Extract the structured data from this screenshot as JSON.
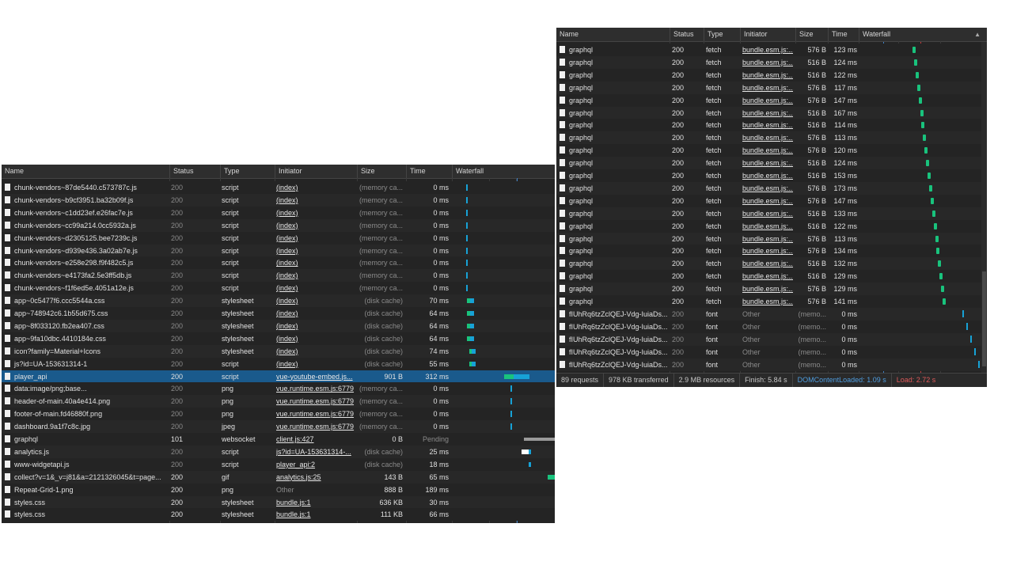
{
  "left": {
    "columns": [
      "Name",
      "Status",
      "Type",
      "Initiator",
      "Size",
      "Time",
      "Waterfall"
    ],
    "rows": [
      {
        "name": "chunk-vendors~87de5440.c573787c.js",
        "status": "200",
        "type": "script",
        "initiator": "(index)",
        "size": "(memory ca...",
        "time": "0 ms",
        "dim": true,
        "wf": "tick"
      },
      {
        "name": "chunk-vendors~b9cf3951.ba32b09f.js",
        "status": "200",
        "type": "script",
        "initiator": "(index)",
        "size": "(memory ca...",
        "time": "0 ms",
        "dim": true,
        "wf": "tick"
      },
      {
        "name": "chunk-vendors~c1dd23ef.e26fac7e.js",
        "status": "200",
        "type": "script",
        "initiator": "(index)",
        "size": "(memory ca...",
        "time": "0 ms",
        "dim": true,
        "wf": "tick"
      },
      {
        "name": "chunk-vendors~cc99a214.0cc5932a.js",
        "status": "200",
        "type": "script",
        "initiator": "(index)",
        "size": "(memory ca...",
        "time": "0 ms",
        "dim": true,
        "wf": "tick"
      },
      {
        "name": "chunk-vendors~d2305125.bee7239c.js",
        "status": "200",
        "type": "script",
        "initiator": "(index)",
        "size": "(memory ca...",
        "time": "0 ms",
        "dim": true,
        "wf": "tick"
      },
      {
        "name": "chunk-vendors~d939e436.3a02ab7e.js",
        "status": "200",
        "type": "script",
        "initiator": "(index)",
        "size": "(memory ca...",
        "time": "0 ms",
        "dim": true,
        "wf": "tick"
      },
      {
        "name": "chunk-vendors~e258e298.f9f482c5.js",
        "status": "200",
        "type": "script",
        "initiator": "(index)",
        "size": "(memory ca...",
        "time": "0 ms",
        "dim": true,
        "wf": "tick"
      },
      {
        "name": "chunk-vendors~e4173fa2.5e3ff5db.js",
        "status": "200",
        "type": "script",
        "initiator": "(index)",
        "size": "(memory ca...",
        "time": "0 ms",
        "dim": true,
        "wf": "tick"
      },
      {
        "name": "chunk-vendors~f1f6ed5e.4051a12e.js",
        "status": "200",
        "type": "script",
        "initiator": "(index)",
        "size": "(memory ca...",
        "time": "0 ms",
        "dim": true,
        "wf": "tick"
      },
      {
        "name": "app~0c5477f6.ccc5544a.css",
        "status": "200",
        "type": "stylesheet",
        "initiator": "(index)",
        "size": "(disk cache)",
        "time": "70 ms",
        "dim": true,
        "wf": "css"
      },
      {
        "name": "app~748942c6.1b55d675.css",
        "status": "200",
        "type": "stylesheet",
        "initiator": "(index)",
        "size": "(disk cache)",
        "time": "64 ms",
        "dim": true,
        "wf": "css"
      },
      {
        "name": "app~8f033120.fb2ea407.css",
        "status": "200",
        "type": "stylesheet",
        "initiator": "(index)",
        "size": "(disk cache)",
        "time": "64 ms",
        "dim": true,
        "wf": "css"
      },
      {
        "name": "app~9fa10dbc.4410184e.css",
        "status": "200",
        "type": "stylesheet",
        "initiator": "(index)",
        "size": "(disk cache)",
        "time": "64 ms",
        "dim": true,
        "wf": "css"
      },
      {
        "name": "icon?family=Material+Icons",
        "status": "200",
        "type": "stylesheet",
        "initiator": "(index)",
        "size": "(disk cache)",
        "time": "74 ms",
        "dim": true,
        "wf": "css2"
      },
      {
        "name": "js?id=UA-153631314-1",
        "status": "200",
        "type": "script",
        "initiator": "(index)",
        "size": "(disk cache)",
        "time": "55 ms",
        "dim": true,
        "wf": "css2"
      },
      {
        "name": "player_api",
        "status": "200",
        "type": "script",
        "initiator": "vue-youtube-embed.js...",
        "size": "901 B",
        "time": "312 ms",
        "dim": false,
        "sel": true,
        "wf": "player"
      },
      {
        "name": "data:image/png;base...",
        "status": "200",
        "type": "png",
        "initiator": "vue.runtime.esm.js:6779",
        "size": "(memory ca...",
        "time": "0 ms",
        "dim": true,
        "wf": "tick2"
      },
      {
        "name": "header-of-main.40a4e414.png",
        "status": "200",
        "type": "png",
        "initiator": "vue.runtime.esm.js:6779",
        "size": "(memory ca...",
        "time": "0 ms",
        "dim": true,
        "wf": "tick2"
      },
      {
        "name": "footer-of-main.fd46880f.png",
        "status": "200",
        "type": "png",
        "initiator": "vue.runtime.esm.js:6779",
        "size": "(memory ca...",
        "time": "0 ms",
        "dim": true,
        "wf": "tick2"
      },
      {
        "name": "dashboard.9a1f7c8c.jpg",
        "status": "200",
        "type": "jpeg",
        "initiator": "vue.runtime.esm.js:6779",
        "size": "(memory ca...",
        "time": "0 ms",
        "dim": true,
        "wf": "tick2"
      },
      {
        "name": "graphql",
        "status": "101",
        "type": "websocket",
        "initiator": "client.js:427",
        "size": "0 B",
        "time": "Pending",
        "dim": false,
        "timedim": true,
        "wf": "ws"
      },
      {
        "name": "analytics.js",
        "status": "200",
        "type": "script",
        "initiator": "js?id=UA-153631314-...",
        "size": "(disk cache)",
        "time": "25 ms",
        "dim": true,
        "wf": "analytics"
      },
      {
        "name": "www-widgetapi.js",
        "status": "200",
        "type": "script",
        "initiator": "player_api:2",
        "size": "(disk cache)",
        "time": "18 ms",
        "dim": true,
        "wf": "widget"
      },
      {
        "name": "collect?v=1&_v=j81&a=2121326045&t=page...",
        "status": "200",
        "type": "gif",
        "initiator": "analytics.js:25",
        "size": "143 B",
        "time": "65 ms",
        "dim": false,
        "wf": "collect"
      },
      {
        "name": "Repeat-Grid-1.png",
        "status": "200",
        "type": "png",
        "initiator": "Other",
        "size": "888 B",
        "time": "189 ms",
        "dim": false,
        "initdim": true,
        "wf": "none"
      },
      {
        "name": "styles.css",
        "status": "200",
        "type": "stylesheet",
        "initiator": "bundle.js:1",
        "size": "636 KB",
        "time": "30 ms",
        "dim": false,
        "wf": "none"
      },
      {
        "name": "styles.css",
        "status": "200",
        "type": "stylesheet",
        "initiator": "bundle.js:1",
        "size": "111 KB",
        "time": "66 ms",
        "dim": false,
        "wf": "none"
      }
    ]
  },
  "right": {
    "columns": [
      "Name",
      "Status",
      "Type",
      "Initiator",
      "Size",
      "Time",
      "Waterfall"
    ],
    "sort_icon": "sort-up-icon",
    "rows": [
      {
        "name": "graphql",
        "status": "200",
        "type": "fetch",
        "initiator": "bundle.esm.js:...",
        "size": "576 B",
        "time": "123 ms"
      },
      {
        "name": "graphql",
        "status": "200",
        "type": "fetch",
        "initiator": "bundle.esm.js:...",
        "size": "516 B",
        "time": "124 ms"
      },
      {
        "name": "graphql",
        "status": "200",
        "type": "fetch",
        "initiator": "bundle.esm.js:...",
        "size": "516 B",
        "time": "122 ms"
      },
      {
        "name": "graphql",
        "status": "200",
        "type": "fetch",
        "initiator": "bundle.esm.js:...",
        "size": "576 B",
        "time": "117 ms"
      },
      {
        "name": "graphql",
        "status": "200",
        "type": "fetch",
        "initiator": "bundle.esm.js:...",
        "size": "576 B",
        "time": "147 ms"
      },
      {
        "name": "graphql",
        "status": "200",
        "type": "fetch",
        "initiator": "bundle.esm.js:...",
        "size": "516 B",
        "time": "167 ms"
      },
      {
        "name": "graphql",
        "status": "200",
        "type": "fetch",
        "initiator": "bundle.esm.js:...",
        "size": "516 B",
        "time": "114 ms"
      },
      {
        "name": "graphql",
        "status": "200",
        "type": "fetch",
        "initiator": "bundle.esm.js:...",
        "size": "576 B",
        "time": "113 ms"
      },
      {
        "name": "graphql",
        "status": "200",
        "type": "fetch",
        "initiator": "bundle.esm.js:...",
        "size": "576 B",
        "time": "120 ms"
      },
      {
        "name": "graphql",
        "status": "200",
        "type": "fetch",
        "initiator": "bundle.esm.js:...",
        "size": "516 B",
        "time": "124 ms"
      },
      {
        "name": "graphql",
        "status": "200",
        "type": "fetch",
        "initiator": "bundle.esm.js:...",
        "size": "516 B",
        "time": "153 ms"
      },
      {
        "name": "graphql",
        "status": "200",
        "type": "fetch",
        "initiator": "bundle.esm.js:...",
        "size": "576 B",
        "time": "173 ms"
      },
      {
        "name": "graphql",
        "status": "200",
        "type": "fetch",
        "initiator": "bundle.esm.js:...",
        "size": "576 B",
        "time": "147 ms"
      },
      {
        "name": "graphql",
        "status": "200",
        "type": "fetch",
        "initiator": "bundle.esm.js:...",
        "size": "516 B",
        "time": "133 ms"
      },
      {
        "name": "graphql",
        "status": "200",
        "type": "fetch",
        "initiator": "bundle.esm.js:...",
        "size": "516 B",
        "time": "122 ms"
      },
      {
        "name": "graphql",
        "status": "200",
        "type": "fetch",
        "initiator": "bundle.esm.js:...",
        "size": "576 B",
        "time": "113 ms"
      },
      {
        "name": "graphql",
        "status": "200",
        "type": "fetch",
        "initiator": "bundle.esm.js:...",
        "size": "576 B",
        "time": "134 ms"
      },
      {
        "name": "graphql",
        "status": "200",
        "type": "fetch",
        "initiator": "bundle.esm.js:...",
        "size": "516 B",
        "time": "132 ms"
      },
      {
        "name": "graphql",
        "status": "200",
        "type": "fetch",
        "initiator": "bundle.esm.js:...",
        "size": "516 B",
        "time": "129 ms"
      },
      {
        "name": "graphql",
        "status": "200",
        "type": "fetch",
        "initiator": "bundle.esm.js:...",
        "size": "576 B",
        "time": "129 ms"
      },
      {
        "name": "graphql",
        "status": "200",
        "type": "fetch",
        "initiator": "bundle.esm.js:...",
        "size": "576 B",
        "time": "141 ms"
      },
      {
        "name": "fIUhRq6tzZclQEJ-Vdg-IuiaDs...",
        "status": "200",
        "type": "font",
        "initiator": "Other",
        "size": "(memo...",
        "time": "0 ms",
        "dim": true
      },
      {
        "name": "fIUhRq6tzZclQEJ-Vdg-IuiaDs...",
        "status": "200",
        "type": "font",
        "initiator": "Other",
        "size": "(memo...",
        "time": "0 ms",
        "dim": true
      },
      {
        "name": "fIUhRq6tzZclQEJ-Vdg-IuiaDs...",
        "status": "200",
        "type": "font",
        "initiator": "Other",
        "size": "(memo...",
        "time": "0 ms",
        "dim": true
      },
      {
        "name": "fIUhRq6tzZclQEJ-Vdg-IuiaDs...",
        "status": "200",
        "type": "font",
        "initiator": "Other",
        "size": "(memo...",
        "time": "0 ms",
        "dim": true
      },
      {
        "name": "fIUhRq6tzZclQEJ-Vdg-IuiaDs...",
        "status": "200",
        "type": "font",
        "initiator": "Other",
        "size": "(memo...",
        "time": "0 ms",
        "dim": true
      }
    ],
    "footer": {
      "requests": "89 requests",
      "transferred": "978 KB transferred",
      "resources": "2.9 MB resources",
      "finish": "Finish: 5.84 s",
      "dcl": "DOMContentLoaded: 1.09 s",
      "load": "Load: 2.72 s"
    }
  },
  "colors": {
    "bg": "#242424",
    "selected": "#1a5a8c",
    "blue": "#3f82c8",
    "red": "#c43c3c",
    "green": "#19c37d",
    "cyan": "#17a2d6"
  }
}
